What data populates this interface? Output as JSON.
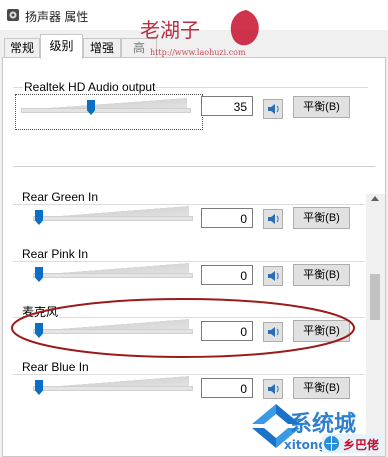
{
  "window": {
    "title": "扬声器 属性"
  },
  "tabs": [
    {
      "label": "常规"
    },
    {
      "label": "级别"
    },
    {
      "label": "增强"
    },
    {
      "label": "高"
    }
  ],
  "levels": [
    {
      "name": "Realtek HD Audio output",
      "value": "35",
      "level_fraction": 0.35,
      "balance_label": "平衡(B)"
    },
    {
      "name": "Rear Green In",
      "value": "0",
      "level_fraction": 0.0,
      "balance_label": "平衡(B)"
    },
    {
      "name": "Rear Pink In",
      "value": "0",
      "level_fraction": 0.0,
      "balance_label": "平衡(B)"
    },
    {
      "name": "麦克风",
      "value": "0",
      "level_fraction": 0.0,
      "balance_label": "平衡(B)"
    },
    {
      "name": "Rear Blue In",
      "value": "0",
      "level_fraction": 0.0,
      "balance_label": "平衡(B)"
    }
  ],
  "watermark": {
    "brand_text": "系统城",
    "latin_text": "xitong",
    "tag_text": "乡巴佬",
    "top_text": "老湖子",
    "url_text": "http://www.laohuzi.com"
  },
  "colors": {
    "slider_thumb": "#0b6fc6",
    "highlight_ellipse": "#9b1b1b",
    "watermark_blue": "#1a73c9"
  }
}
